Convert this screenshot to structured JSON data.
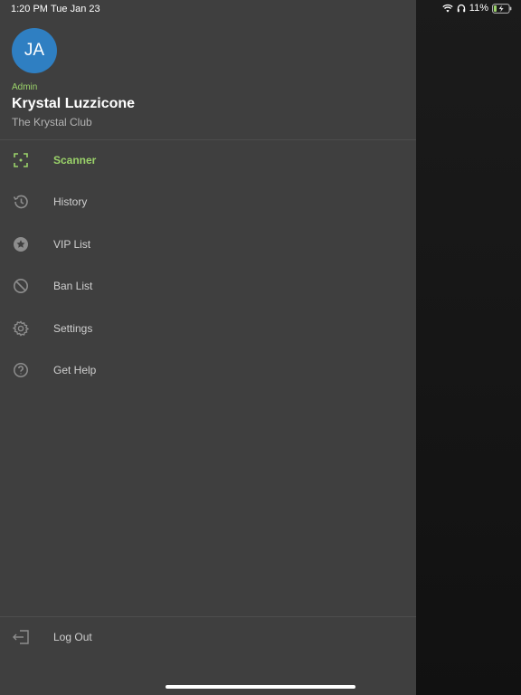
{
  "status_bar": {
    "time": "1:20 PM",
    "date": "Tue Jan 23",
    "battery_percent": "11%",
    "icons": [
      "wifi-icon",
      "headphones-icon",
      "battery-charging-icon"
    ]
  },
  "profile": {
    "initials": "JA",
    "role": "Admin",
    "name": "Krystal Luzzicone",
    "club": "The Krystal Club",
    "avatar_color": "#2f7fc2"
  },
  "menu": {
    "items": [
      {
        "label": "Scanner",
        "icon": "scanner-icon",
        "active": true
      },
      {
        "label": "History",
        "icon": "history-icon",
        "active": false
      },
      {
        "label": "VIP List",
        "icon": "star-icon",
        "active": false
      },
      {
        "label": "Ban List",
        "icon": "ban-icon",
        "active": false
      },
      {
        "label": "Settings",
        "icon": "gear-icon",
        "active": false
      },
      {
        "label": "Get Help",
        "icon": "help-icon",
        "active": false
      }
    ]
  },
  "footer": {
    "logout_label": "Log Out",
    "logout_icon": "logout-icon"
  },
  "colors": {
    "accent": "#9bd36a",
    "drawer_background": "#3f3f3f",
    "backdrop": "#141414"
  }
}
